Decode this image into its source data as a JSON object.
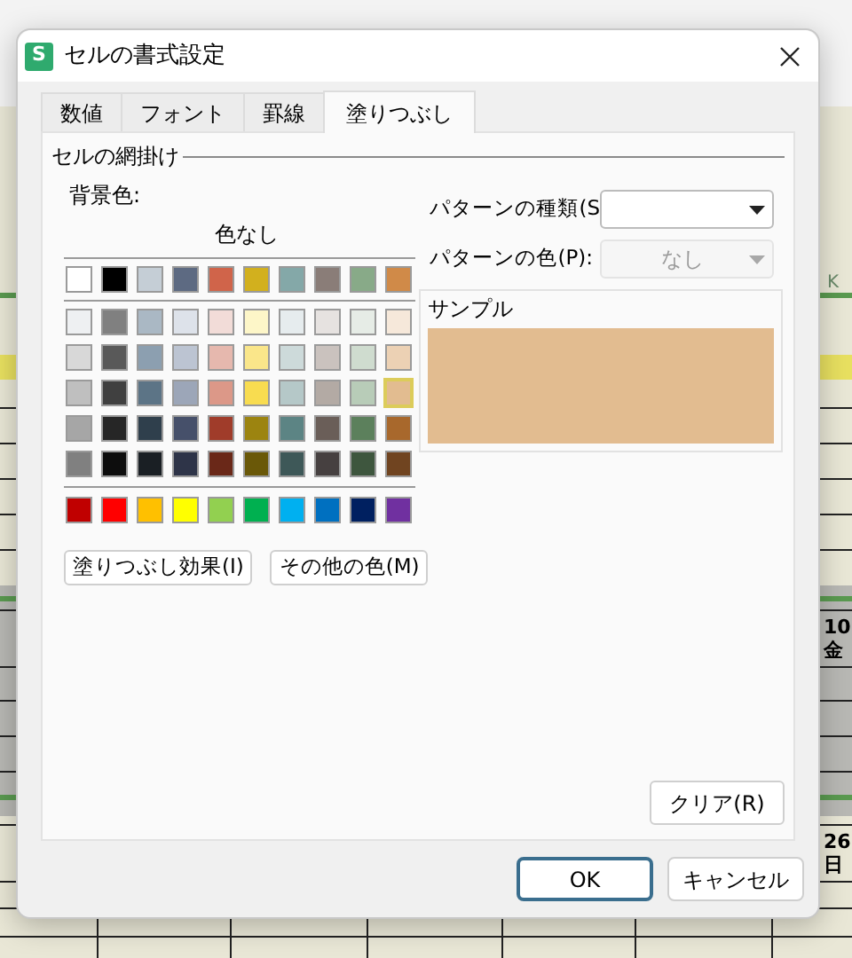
{
  "background": {
    "column_header": "K",
    "cells": [
      "10",
      "金",
      "26",
      "日"
    ]
  },
  "window": {
    "icon_letter": "S",
    "title": "セルの書式設定"
  },
  "tabs": [
    {
      "label": "数値",
      "selected": false
    },
    {
      "label": "フォント",
      "selected": false
    },
    {
      "label": "罫線",
      "selected": false
    },
    {
      "label": "塗りつぶし",
      "selected": true
    }
  ],
  "section_title": "セルの網掛け",
  "background_color_label": "背景色:",
  "no_color_label": "色なし",
  "palette": {
    "basic": [
      {
        "color": "#ffffff",
        "selected": false
      },
      {
        "color": "#000000",
        "selected": false
      },
      {
        "color": "#c5ced6",
        "selected": false
      },
      {
        "color": "#5d6a82",
        "selected": false
      },
      {
        "color": "#d0644a",
        "selected": false
      },
      {
        "color": "#d2b01e",
        "selected": false
      },
      {
        "color": "#84a8a8",
        "selected": false
      },
      {
        "color": "#8a7d78",
        "selected": false
      },
      {
        "color": "#88aa88",
        "selected": false
      },
      {
        "color": "#d08a48",
        "selected": false
      }
    ],
    "tints": [
      [
        {
          "color": "#eef0f2",
          "selected": false
        },
        {
          "color": "#808080",
          "selected": false
        },
        {
          "color": "#aab8c4",
          "selected": false
        },
        {
          "color": "#dde2ea",
          "selected": false
        },
        {
          "color": "#f2dcd8",
          "selected": false
        },
        {
          "color": "#fdf6c8",
          "selected": false
        },
        {
          "color": "#e6ecee",
          "selected": false
        },
        {
          "color": "#e6e2e0",
          "selected": false
        },
        {
          "color": "#e6ece6",
          "selected": false
        },
        {
          "color": "#f6e8da",
          "selected": false
        }
      ],
      [
        {
          "color": "#d8d8d8",
          "selected": false
        },
        {
          "color": "#595959",
          "selected": false
        },
        {
          "color": "#8c9fb0",
          "selected": false
        },
        {
          "color": "#bcc4d2",
          "selected": false
        },
        {
          "color": "#e6b8ae",
          "selected": false
        },
        {
          "color": "#fae68a",
          "selected": false
        },
        {
          "color": "#cddada",
          "selected": false
        },
        {
          "color": "#cac2be",
          "selected": false
        },
        {
          "color": "#cfdccf",
          "selected": false
        },
        {
          "color": "#ecd1b4",
          "selected": false
        }
      ],
      [
        {
          "color": "#bfbfbf",
          "selected": false
        },
        {
          "color": "#404040",
          "selected": false
        },
        {
          "color": "#5c7486",
          "selected": false
        },
        {
          "color": "#9ca6b8",
          "selected": false
        },
        {
          "color": "#dc9888",
          "selected": false
        },
        {
          "color": "#f8dc50",
          "selected": false
        },
        {
          "color": "#b5c8c8",
          "selected": false
        },
        {
          "color": "#b3aaa4",
          "selected": false
        },
        {
          "color": "#b8ccb8",
          "selected": false
        },
        {
          "color": "#e2bc90",
          "selected": true
        }
      ],
      [
        {
          "color": "#a6a6a6",
          "selected": false
        },
        {
          "color": "#262626",
          "selected": false
        },
        {
          "color": "#2f3f4c",
          "selected": false
        },
        {
          "color": "#46506a",
          "selected": false
        },
        {
          "color": "#a03c2a",
          "selected": false
        },
        {
          "color": "#9c8410",
          "selected": false
        },
        {
          "color": "#5c8484",
          "selected": false
        },
        {
          "color": "#6a5e58",
          "selected": false
        },
        {
          "color": "#5c805c",
          "selected": false
        },
        {
          "color": "#a8682c",
          "selected": false
        }
      ],
      [
        {
          "color": "#808080",
          "selected": false
        },
        {
          "color": "#0d0d0d",
          "selected": false
        },
        {
          "color": "#1a1f24",
          "selected": false
        },
        {
          "color": "#2e3448",
          "selected": false
        },
        {
          "color": "#6a2818",
          "selected": false
        },
        {
          "color": "#6a5808",
          "selected": false
        },
        {
          "color": "#3e5858",
          "selected": false
        },
        {
          "color": "#464040",
          "selected": false
        },
        {
          "color": "#3e563e",
          "selected": false
        },
        {
          "color": "#704420",
          "selected": false
        }
      ]
    ],
    "standard": [
      {
        "color": "#c00000",
        "selected": false
      },
      {
        "color": "#ff0000",
        "selected": false
      },
      {
        "color": "#ffc000",
        "selected": false
      },
      {
        "color": "#ffff00",
        "selected": false
      },
      {
        "color": "#92d050",
        "selected": false
      },
      {
        "color": "#00b050",
        "selected": false
      },
      {
        "color": "#00b0f0",
        "selected": false
      },
      {
        "color": "#0070c0",
        "selected": false
      },
      {
        "color": "#002060",
        "selected": false
      },
      {
        "color": "#7030a0",
        "selected": false
      }
    ]
  },
  "fill_buttons": [
    "塗りつぶし効果(I)",
    "その他の色(M)"
  ],
  "pattern_style": {
    "label": "パターンの種類(S",
    "disabled": false
  },
  "pattern_color": {
    "label": "パターンの色(P):",
    "value": "なし",
    "disabled": true
  },
  "sample_label": "サンプル",
  "clear_button": "クリア(R)",
  "buttons": [
    {
      "label": "OK",
      "kind": "primary"
    },
    {
      "label": "キャンセル",
      "kind": "secondary"
    }
  ]
}
